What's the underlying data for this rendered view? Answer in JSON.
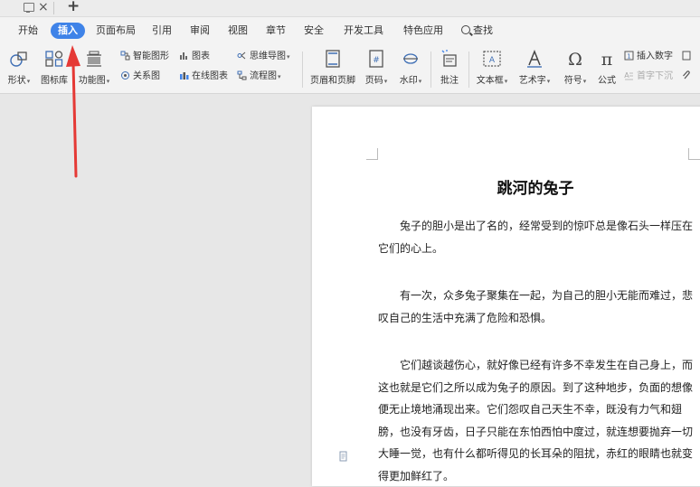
{
  "titlebar": {
    "close_glyph": "×",
    "new_tab_glyph": "+"
  },
  "menu": {
    "tabs": [
      {
        "label": "开始"
      },
      {
        "label": "插入",
        "active": true
      },
      {
        "label": "页面布局"
      },
      {
        "label": "引用"
      },
      {
        "label": "审阅"
      },
      {
        "label": "视图"
      },
      {
        "label": "章节"
      },
      {
        "label": "安全"
      },
      {
        "label": "开发工具"
      },
      {
        "label": "特色应用"
      }
    ],
    "search_label": "查找"
  },
  "ribbon": {
    "shape": "形状",
    "icon_lib": "图标库",
    "func_chart": "功能图",
    "smart_art": "智能图形",
    "relation": "关系图",
    "chart": "图表",
    "online_chart": "在线图表",
    "mind_map": "思维导图",
    "flowchart": "流程图",
    "header_footer": "页眉和页脚",
    "page_number": "页码",
    "watermark": "水印",
    "comment": "批注",
    "textbox": "文本框",
    "wordart": "艺术字",
    "symbol": "符号",
    "formula": "公式",
    "insert_number": "插入数字",
    "drop_cap": "首字下沉"
  },
  "document": {
    "title": "跳河的兔子",
    "paragraphs": [
      "兔子的胆小是出了名的，经常受到的惊吓总是像石头一样压在它们的心上。",
      "有一次，众多兔子聚集在一起，为自己的胆小无能而难过，悲叹自己的生活中充满了危险和恐惧。",
      "它们越谈越伤心，就好像已经有许多不幸发生在自己身上，而这也就是它们之所以成为兔子的原因。到了这种地步，负面的想像便无止境地涌现出来。它们怨叹自己天生不幸，既没有力气和翅膀，也没有牙齿，日子只能在东怕西怕中度过，就连想要抛弃一切大睡一觉，也有什么都听得见的长耳朵的阻扰，赤红的眼睛也就变得更加鲜红了。"
    ]
  },
  "colors": {
    "accent": "#3f83e8",
    "arrow": "#e53935"
  }
}
